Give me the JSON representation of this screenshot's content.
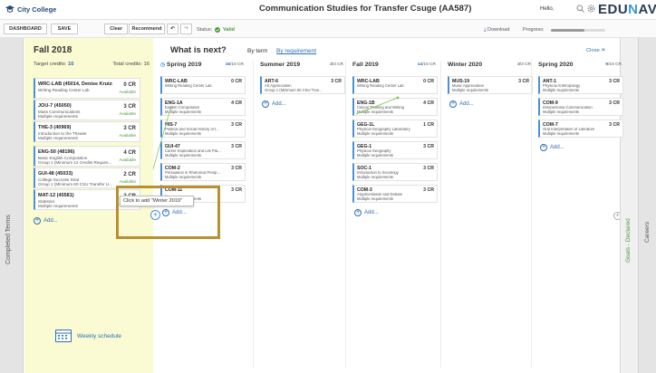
{
  "header": {
    "college": "City College",
    "title": "Communication Studies for Transfer Csuge (AA587)",
    "hello": "Hello,",
    "brand_prefix": "EDU",
    "brand_accent": "N",
    "brand_suffix": "AV"
  },
  "toolbar": {
    "dashboard": "DASHBOARD",
    "save": "SAVE",
    "clear": "Clear",
    "recommend": "Recommend",
    "status_label": "Status:",
    "status_value": "Valid",
    "download": "Download",
    "progress_label": "Progress:",
    "progress_fraction": 0.62
  },
  "sidebars": {
    "left": "Completed Terms",
    "goals": "Goals - Declared",
    "careers": "Careers"
  },
  "fall": {
    "title": "Fall 2018",
    "target_label": "Target credits:",
    "target_value": "16",
    "total_label": "Total credits: 16",
    "courses": [
      {
        "code": "WRC-LAB (45014, Denise Kruizenga...",
        "desc": "Writing Reading Center Lab",
        "desc2": "",
        "cr": "0 CR",
        "avail": "Available"
      },
      {
        "code": "JOU-7 (45050)",
        "desc": "Mass Communications",
        "desc2": "Multiple requirements",
        "cr": "3 CR",
        "avail": "Available"
      },
      {
        "code": "THE-3 (40969)",
        "desc": "Introduction to the Theater",
        "desc2": "Multiple requirements",
        "cr": "3 CR",
        "avail": "Available"
      },
      {
        "code": "ENG-50 (48196)",
        "desc": "Basic English Composition",
        "desc2": "Group 1 (Minimum 12 Credits Require...",
        "cr": "4 CR",
        "avail": "Available"
      },
      {
        "code": "GUI-48 (45033)",
        "desc": "College Success Strat",
        "desc2": "Group 1 (Minimum 60 CSU Transfer U...",
        "cr": "2 CR",
        "avail": "Available"
      },
      {
        "code": "MAT-12 (45581)",
        "desc": "Statistics",
        "desc2": "Multiple requirements",
        "cr": "3 CR",
        "avail": "Available"
      }
    ],
    "add": "Add...",
    "weekly": "Weekly schedule"
  },
  "main": {
    "title": "What is next?",
    "by_term": "By term",
    "by_requirement": "By requirement",
    "close": "Close ✕",
    "tooltip": "Click to add \"Winter 2019\"",
    "add": "Add...",
    "terms": [
      {
        "name": "Spring 2019",
        "cr_num": "16",
        "cr_den": "/16 CR",
        "courses": [
          {
            "code": "WRC-LAB",
            "cr": "0 CR",
            "desc": "Writing Reading Center Lab",
            "desc2": ""
          },
          {
            "code": "ENG-1A",
            "cr": "4 CR",
            "desc": "English Composition",
            "desc2": "Multiple requirements"
          },
          {
            "code": "HIS-7",
            "cr": "3 CR",
            "desc": "Political and Social History of t...",
            "desc2": "Multiple requirements"
          },
          {
            "code": "GUI-47",
            "cr": "3 CR",
            "desc": "Career Exploration and Life Pla...",
            "desc2": "Multiple requirements"
          },
          {
            "code": "COM-2",
            "cr": "3 CR",
            "desc": "Persuasion in Rhetorical Persp...",
            "desc2": "Multiple requirements"
          },
          {
            "code": "COM-11",
            "cr": "3 CR",
            "desc": "...",
            "desc2": "Multiple requirements"
          }
        ]
      },
      {
        "name": "Summer 2019",
        "cr_num": "3",
        "cr_den": "/3 CR",
        "courses": [
          {
            "code": "ART-6",
            "cr": "3 CR",
            "desc": "Art Appreciation",
            "desc2": "Group 1 (Minimum 60 CSU Tran..."
          }
        ]
      },
      {
        "name": "Fall 2019",
        "cr_num": "14",
        "cr_den": "/16 CR",
        "courses": [
          {
            "code": "WRC-LAB",
            "cr": "0 CR",
            "desc": "Writing Reading Center Lab",
            "desc2": ""
          },
          {
            "code": "ENG-1B",
            "cr": "4 CR",
            "desc": "Critical Thinking and Writing",
            "desc2": "Multiple requirements"
          },
          {
            "code": "GEG-1L",
            "cr": "1 CR",
            "desc": "Physical Geography Laboratory",
            "desc2": "Multiple requirements"
          },
          {
            "code": "GEG-1",
            "cr": "3 CR",
            "desc": "Physical Geography",
            "desc2": "Multiple requirements"
          },
          {
            "code": "SOC-1",
            "cr": "3 CR",
            "desc": "Introduction to Sociology",
            "desc2": "Multiple requirements"
          },
          {
            "code": "COM-3",
            "cr": "3 CR",
            "desc": "Argumentation and Debate",
            "desc2": "Multiple requirements"
          }
        ]
      },
      {
        "name": "Winter 2020",
        "cr_num": "3",
        "cr_den": "/3 CR",
        "courses": [
          {
            "code": "MUS-19",
            "cr": "3 CR",
            "desc": "Music Appreciation",
            "desc2": "Multiple requirements"
          }
        ]
      },
      {
        "name": "Spring 2020",
        "cr_num": "9",
        "cr_den": "/16 CR",
        "courses": [
          {
            "code": "ANT-1",
            "cr": "3 CR",
            "desc": "Physical Anthropology",
            "desc2": "Multiple requirements"
          },
          {
            "code": "COM-9",
            "cr": "3 CR",
            "desc": "Interpersonal Communication",
            "desc2": "Multiple requirements"
          },
          {
            "code": "COM-7",
            "cr": "3 CR",
            "desc": "Oral Interpretation of Literature",
            "desc2": "Multiple requirements"
          }
        ]
      }
    ]
  }
}
